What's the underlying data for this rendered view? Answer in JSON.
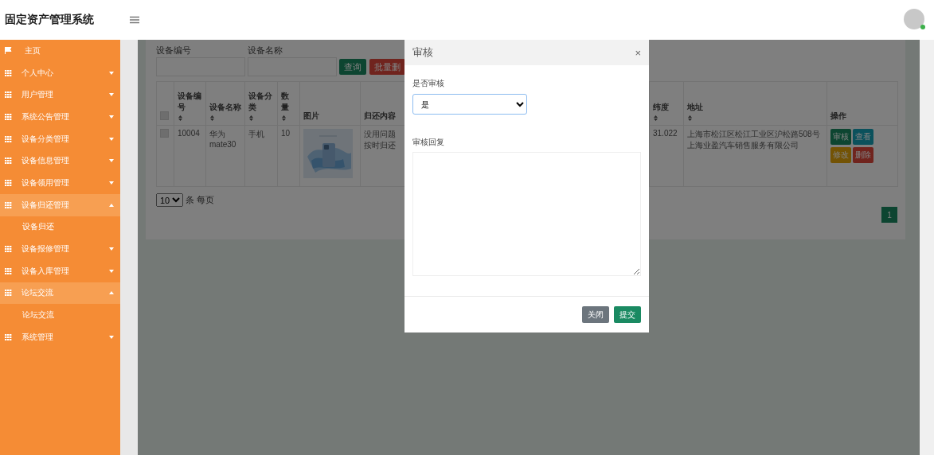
{
  "app": {
    "title": "固定资产管理系统"
  },
  "sidebar": {
    "items": [
      {
        "kind": "link",
        "label": "主页"
      },
      {
        "kind": "group",
        "label": "个人中心",
        "expanded": false
      },
      {
        "kind": "group",
        "label": "用户管理",
        "expanded": false
      },
      {
        "kind": "group",
        "label": "系统公告管理",
        "expanded": false
      },
      {
        "kind": "group",
        "label": "设备分类管理",
        "expanded": false
      },
      {
        "kind": "group",
        "label": "设备信息管理",
        "expanded": false
      },
      {
        "kind": "group",
        "label": "设备领用管理",
        "expanded": false
      },
      {
        "kind": "group",
        "label": "设备归还管理",
        "expanded": true,
        "children": [
          {
            "label": "设备归还"
          }
        ]
      },
      {
        "kind": "group",
        "label": "设备报修管理",
        "expanded": false
      },
      {
        "kind": "group",
        "label": "设备入库管理",
        "expanded": false
      },
      {
        "kind": "group",
        "label": "论坛交流",
        "expanded": true,
        "children": [
          {
            "label": "论坛交流"
          }
        ]
      },
      {
        "kind": "group",
        "label": "系统管理",
        "expanded": false
      }
    ]
  },
  "search": {
    "fields": [
      {
        "label": "设备编号"
      },
      {
        "label": "设备名称"
      }
    ],
    "buttons": [
      {
        "label": "查询",
        "kind": "success"
      },
      {
        "label": "批量删",
        "kind": "danger"
      }
    ]
  },
  "table": {
    "columns": [
      {
        "kind": "checkbox",
        "checked": false
      },
      {
        "kind": "text",
        "label": "设备编号",
        "sortable": true
      },
      {
        "kind": "text",
        "label": "设备名称",
        "sortable": true
      },
      {
        "kind": "text",
        "label": "设备分类",
        "sortable": true
      },
      {
        "kind": "text",
        "label": "数量",
        "sortable": true
      },
      {
        "kind": "text",
        "label": "图片",
        "sortable": false
      },
      {
        "kind": "text",
        "label": "归还内容",
        "sortable": false
      },
      {
        "kind": "text",
        "label": "纬度",
        "sortable": true
      },
      {
        "kind": "text",
        "label": "地址",
        "sortable": true
      },
      {
        "kind": "text",
        "label": "操作",
        "sortable": false
      }
    ],
    "rows": [
      {
        "cells": [
          {
            "kind": "checkbox",
            "checked": false
          },
          {
            "kind": "text",
            "text": "10004"
          },
          {
            "kind": "text",
            "text": "华为mate30"
          },
          {
            "kind": "text",
            "text": "手机"
          },
          {
            "kind": "text",
            "text": "10"
          },
          {
            "kind": "picture"
          },
          {
            "kind": "text",
            "text": "没用问题按时归还"
          },
          {
            "kind": "text",
            "text": "31.022"
          },
          {
            "kind": "text",
            "text": "上海市松江区松江工业区沪松路508号上海业盈汽车销售服务有限公司"
          },
          {
            "kind": "actions",
            "buttons": [
              {
                "label": "审核",
                "kind": "success"
              },
              {
                "label": "查看",
                "kind": "info"
              },
              {
                "label": "修改",
                "kind": "warning"
              },
              {
                "label": "删除",
                "kind": "danger"
              }
            ]
          }
        ]
      }
    ]
  },
  "pagination": {
    "page_size": "10",
    "page_size_label": "条 每页",
    "pages": [
      {
        "label": "1",
        "selected": true
      }
    ]
  },
  "modal": {
    "title": "审核",
    "close_label": "×",
    "fields": [
      {
        "kind": "select",
        "label": "是否审核",
        "value": "是"
      },
      {
        "kind": "textarea",
        "label": "审核回复"
      }
    ],
    "buttons": [
      {
        "label": "关闭",
        "kind": "secondary"
      },
      {
        "label": "提交",
        "kind": "success"
      }
    ]
  }
}
